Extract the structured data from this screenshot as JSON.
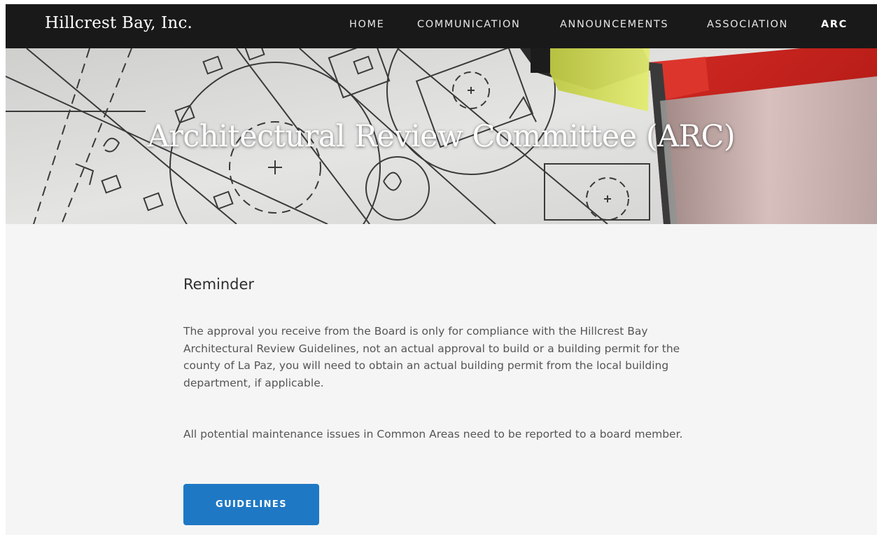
{
  "header": {
    "brand": "Hillcrest Bay, Inc.",
    "nav": [
      {
        "label": "HOME",
        "active": false
      },
      {
        "label": "COMMUNICATION",
        "active": false
      },
      {
        "label": "ANNOUNCEMENTS",
        "active": false
      },
      {
        "label": "ASSOCIATION",
        "active": false
      },
      {
        "label": "ARC",
        "active": true
      }
    ]
  },
  "hero": {
    "title": "Architectural Review Committee (ARC)",
    "image": "architectural-blueprint-with-level"
  },
  "main": {
    "heading": "Reminder",
    "paragraphs": [
      "The approval you receive from the Board is only for compliance with the Hillcrest Bay Architectural Review Guidelines, not an actual approval to build or a building permit for the county of La Paz, you will need to obtain an actual building permit from the local building department, if applicable.",
      "All potential maintenance issues in Common Areas need to be reported to a board member."
    ],
    "button_label": "GUIDELINES"
  },
  "colors": {
    "nav_background": "#191919",
    "page_background": "#f5f5f5",
    "button": "#1f78c4",
    "level_red": "#c62020",
    "level_yellow": "#d6e25a"
  }
}
